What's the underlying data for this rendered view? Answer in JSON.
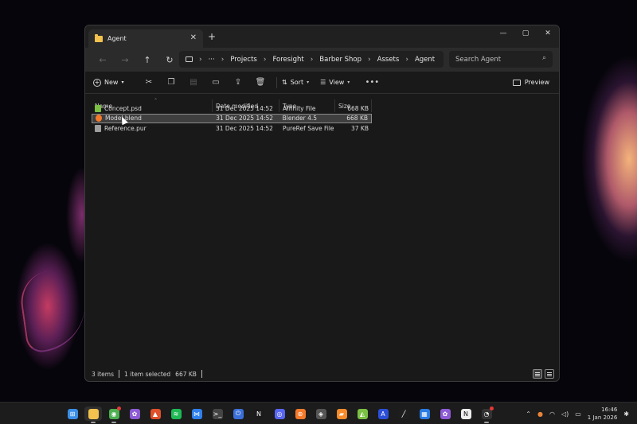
{
  "window": {
    "tab_title": "Agent",
    "tab_close": "✕",
    "tab_new": "+",
    "controls": {
      "minimize": "—",
      "maximize": "▢",
      "close": "✕"
    }
  },
  "navbar": {
    "back": "←",
    "forward": "→",
    "up": "↑",
    "refresh": "↻",
    "breadcrumb": {
      "overflow": "···",
      "items": [
        "Projects",
        "Foresight",
        "Barber Shop",
        "Assets",
        "Agent"
      ],
      "sep": "›"
    },
    "search_placeholder": "Search Agent"
  },
  "toolbar": {
    "new_label": "New",
    "sort_label": "Sort",
    "view_label": "View",
    "more": "•••",
    "preview_label": "Preview"
  },
  "columns": {
    "name": "Name",
    "date": "Date modified",
    "type": "Type",
    "size": "Size"
  },
  "files": [
    {
      "name": "Concept.psd",
      "date": "31 Dec 2025 14:52",
      "type": "Affinity File",
      "size": "668 KB",
      "icon_color": "#7bc043",
      "selected": false
    },
    {
      "name": "Model.blend",
      "date": "31 Dec 2025 14:52",
      "type": "Blender 4.5",
      "size": "668 KB",
      "icon_color": "#f5792a",
      "selected": true
    },
    {
      "name": "Reference.pur",
      "date": "31 Dec 2025 14:52",
      "type": "PureRef Save File",
      "size": "37 KB",
      "icon_color": "#9e9e9e",
      "selected": false
    }
  ],
  "status": {
    "items": "3 items",
    "selected": "1 item selected",
    "size": "667 KB"
  },
  "taskbar": {
    "apps": [
      {
        "name": "start",
        "color": "#3a8ee6",
        "glyph": "⊞"
      },
      {
        "name": "file-explorer",
        "color": "#f2c14e",
        "glyph": "",
        "active": true
      },
      {
        "name": "chrome",
        "color": "#4caf50",
        "glyph": "◉",
        "badge": true
      },
      {
        "name": "affinity",
        "color": "#8e5bd6",
        "glyph": "✿"
      },
      {
        "name": "app-orange",
        "color": "#e0502a",
        "glyph": "▲"
      },
      {
        "name": "spotify",
        "color": "#1db954",
        "glyph": "≋"
      },
      {
        "name": "vscode",
        "color": "#2f80ed",
        "glyph": "⋈"
      },
      {
        "name": "terminal",
        "color": "#444444",
        "glyph": ">_"
      },
      {
        "name": "power-app",
        "color": "#3b6fd8",
        "glyph": "⏻"
      },
      {
        "name": "notion-like",
        "color": "#1b1b1b",
        "glyph": "N"
      },
      {
        "name": "discord",
        "color": "#5865f2",
        "glyph": "◎"
      },
      {
        "name": "blender",
        "color": "#f5792a",
        "glyph": "⊛"
      },
      {
        "name": "davinci",
        "color": "#555555",
        "glyph": "◈"
      },
      {
        "name": "folder-app",
        "color": "#f58b2a",
        "glyph": "▰"
      },
      {
        "name": "affinity-designer",
        "color": "#7bc043",
        "glyph": "◭"
      },
      {
        "name": "app-a",
        "color": "#2b4fd8",
        "glyph": "A"
      },
      {
        "name": "pen-tool",
        "color": "#1e1e1e",
        "glyph": "╱"
      },
      {
        "name": "ms-store",
        "color": "#2a7be4",
        "glyph": "▦"
      },
      {
        "name": "affinity-photo",
        "color": "#8e5bd6",
        "glyph": "✿"
      },
      {
        "name": "notion",
        "color": "#eeeeee",
        "glyph": "N"
      },
      {
        "name": "speedtest",
        "color": "#333333",
        "glyph": "◔",
        "badge": true
      }
    ],
    "tray": {
      "chevron": "⌃",
      "mic": "🎙",
      "wifi": "◠",
      "volume": "🔊",
      "battery": "▭",
      "time": "16:46",
      "date": "1 Jan 2026",
      "notify": "✱"
    }
  }
}
